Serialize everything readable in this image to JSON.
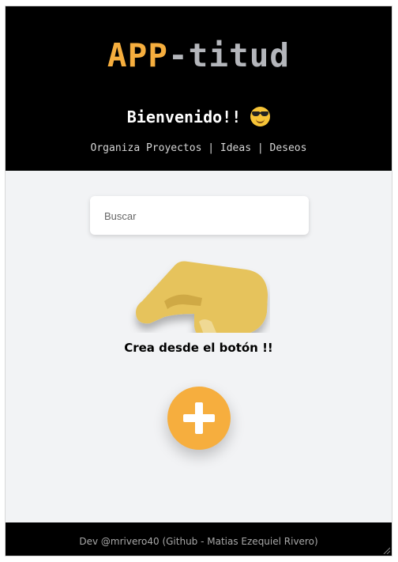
{
  "header": {
    "brand_part1": "APP",
    "brand_part2": "-titud",
    "welcome": "Bienvenido!!",
    "emoji_icon": "smiling-face-with-sunglasses",
    "tagline": "Organiza Proyectos | Ideas | Deseos"
  },
  "search": {
    "placeholder": "Buscar",
    "value": ""
  },
  "main": {
    "illustration_icon": "pointing-hand",
    "cta_text": "Crea desde el botón !!",
    "add_button_icon": "plus-icon"
  },
  "footer": {
    "credit": "Dev @mrivero40 (Github - Matias Ezequiel Rivero)"
  },
  "colors": {
    "header_bg": "#000000",
    "brand_orange": "#f6ae3e",
    "brand_gray": "#b4b6bb",
    "page_bg": "#f2f3f5",
    "hand_yellow": "#e6c35c"
  }
}
